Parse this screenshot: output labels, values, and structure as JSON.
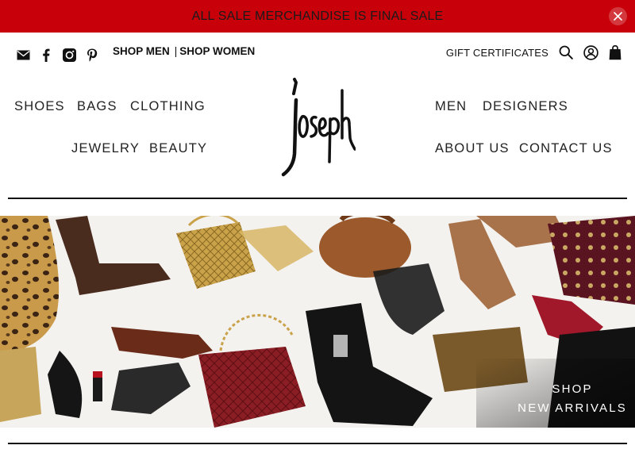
{
  "announcement": {
    "text": "ALL SALE MERCHANDISE IS FINAL SALE",
    "close_icon": "close-icon"
  },
  "social": [
    {
      "icon": "email-icon"
    },
    {
      "icon": "facebook-icon"
    },
    {
      "icon": "instagram-icon"
    },
    {
      "icon": "pinterest-icon"
    }
  ],
  "shop_links": {
    "men": "SHOP MEN",
    "separator": "|",
    "women": "SHOP WOMEN"
  },
  "utility": {
    "gift_certificates": "GIFT CERTIFICATES",
    "search_icon": "search-icon",
    "account_icon": "account-icon",
    "cart_icon": "bag-icon"
  },
  "brand": {
    "logo_text": "joseph"
  },
  "nav": {
    "shoes": "SHOES",
    "bags": "BAGS",
    "clothing": "CLOTHING",
    "jewelry": "JEWELRY",
    "beauty": "BEAUTY",
    "men": "MEN",
    "designers": "DESIGNERS",
    "about": "ABOUT US",
    "contact": "CONTACT US"
  },
  "hero": {
    "cta_line1": "SHOP",
    "cta_line2": "NEW ARRIVALS"
  },
  "colors": {
    "announcement_bg": "#c8000a",
    "text": "#111111"
  }
}
